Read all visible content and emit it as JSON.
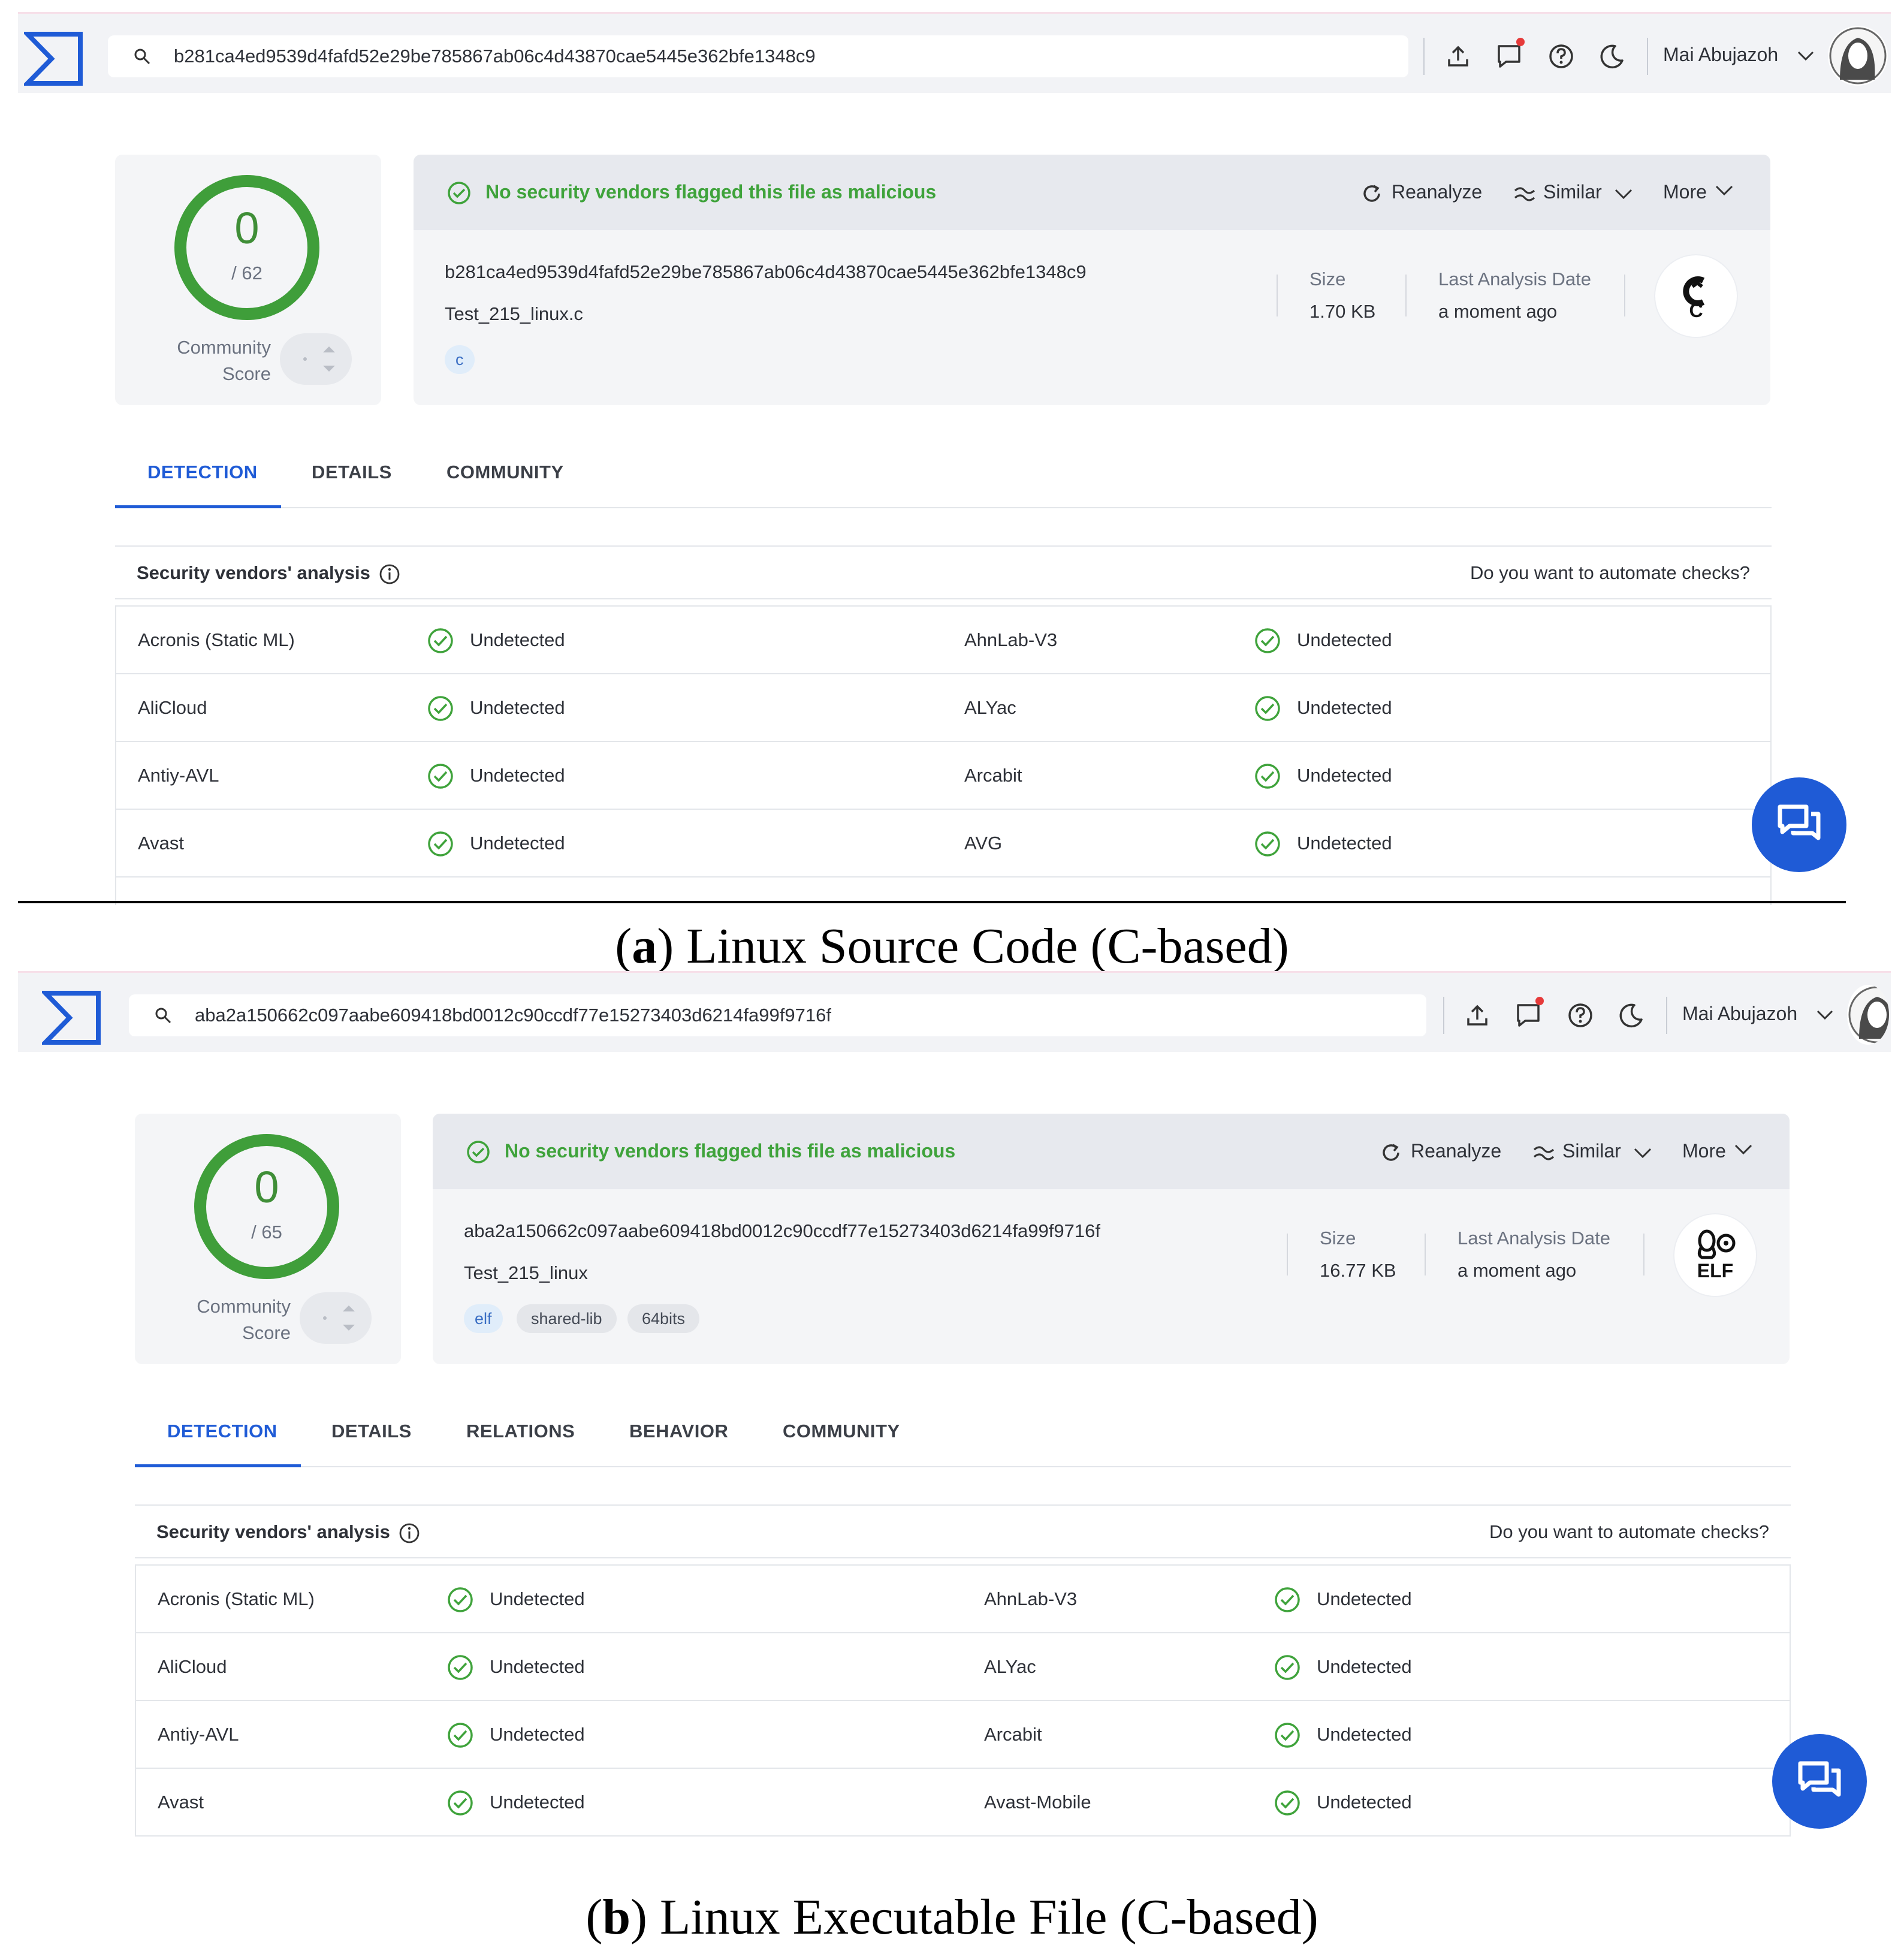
{
  "panels": [
    {
      "id": "a",
      "search_value": "b281ca4ed9539d4fafd52e29be785867ab06c4d43870cae5445e362bfe1348c9",
      "user_name": "Mai Abujazoh",
      "score": {
        "detections": "0",
        "total": "/ 62"
      },
      "community_label": "Community Score",
      "banner_text": "No security vendors flagged this file as malicious",
      "actions": {
        "reanalyze": "Reanalyze",
        "similar": "Similar",
        "more": "More"
      },
      "file_hash": "b281ca4ed9539d4fafd52e29be785867ab06c4d43870cae5445e362bfe1348c9",
      "file_name": "Test_215_linux.c",
      "tags": [
        "c"
      ],
      "size_label": "Size",
      "size_value": "1.70 KB",
      "date_label": "Last Analysis Date",
      "date_value": "a moment ago",
      "file_type_icon": "c-language-icon",
      "file_type_label": "C",
      "tabs": [
        "DETECTION",
        "DETAILS",
        "COMMUNITY"
      ],
      "active_tab": "DETECTION",
      "section_title": "Security vendors' analysis",
      "automate_text": "Do you want to automate checks?",
      "vendors": [
        {
          "left": "Acronis (Static ML)",
          "left_status": "Undetected",
          "right": "AhnLab-V3",
          "right_status": "Undetected"
        },
        {
          "left": "AliCloud",
          "left_status": "Undetected",
          "right": "ALYac",
          "right_status": "Undetected"
        },
        {
          "left": "Antiy-AVL",
          "left_status": "Undetected",
          "right": "Arcabit",
          "right_status": "Undetected"
        },
        {
          "left": "Avast",
          "left_status": "Undetected",
          "right": "AVG",
          "right_status": "Undetected"
        }
      ],
      "caption_letter": "a",
      "caption_text": "Linux Source Code (C-based)"
    },
    {
      "id": "b",
      "search_value": "aba2a150662c097aabe609418bd0012c90ccdf77e15273403d6214fa99f9716f",
      "user_name": "Mai Abujazoh",
      "score": {
        "detections": "0",
        "total": "/ 65"
      },
      "community_label": "Community Score",
      "banner_text": "No security vendors flagged this file as malicious",
      "actions": {
        "reanalyze": "Reanalyze",
        "similar": "Similar",
        "more": "More"
      },
      "file_hash": "aba2a150662c097aabe609418bd0012c90ccdf77e15273403d6214fa99f9716f",
      "file_name": "Test_215_linux",
      "tags": [
        "elf",
        "shared-lib",
        "64bits"
      ],
      "size_label": "Size",
      "size_value": "16.77 KB",
      "date_label": "Last Analysis Date",
      "date_value": "a moment ago",
      "file_type_icon": "linux-elf-icon",
      "file_type_label": "ELF",
      "tabs": [
        "DETECTION",
        "DETAILS",
        "RELATIONS",
        "BEHAVIOR",
        "COMMUNITY"
      ],
      "active_tab": "DETECTION",
      "section_title": "Security vendors' analysis",
      "automate_text": "Do you want to automate checks?",
      "vendors": [
        {
          "left": "Acronis (Static ML)",
          "left_status": "Undetected",
          "right": "AhnLab-V3",
          "right_status": "Undetected"
        },
        {
          "left": "AliCloud",
          "left_status": "Undetected",
          "right": "ALYac",
          "right_status": "Undetected"
        },
        {
          "left": "Antiy-AVL",
          "left_status": "Undetected",
          "right": "Arcabit",
          "right_status": "Undetected"
        },
        {
          "left": "Avast",
          "left_status": "Undetected",
          "right": "Avast-Mobile",
          "right_status": "Undetected"
        }
      ],
      "caption_letter": "b",
      "caption_text": "Linux Executable File (C-based)"
    }
  ],
  "colors": {
    "accent": "#1f5bd6",
    "clean": "#3fa33b",
    "ring": "#3f9e3a"
  }
}
